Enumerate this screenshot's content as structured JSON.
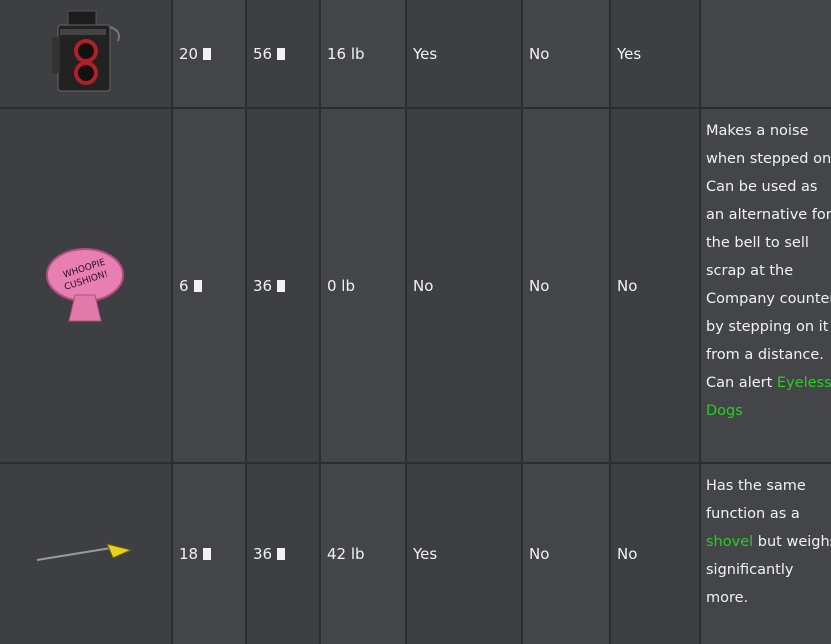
{
  "rows": [
    {
      "icon": "boombox-icon",
      "value_min": "20",
      "value_max": "56",
      "weight": "16 lb",
      "col5": "Yes",
      "col6": "No",
      "col7": "Yes",
      "description": []
    },
    {
      "icon": "whoopie-cushion-icon",
      "value_min": "6",
      "value_max": "36",
      "weight": "0 lb",
      "col5": "No",
      "col6": "No",
      "col7": "No",
      "description": [
        "Makes a noise when stepped on",
        "Can be used as an alternative for the bell to sell scrap at the Company counter by stepping on it from a distance.",
        "Can alert",
        "Eyeless Dogs"
      ],
      "description_link": "Eyeless Dogs"
    },
    {
      "icon": "yield-sign-icon",
      "value_min": "18",
      "value_max": "36",
      "weight": "42 lb",
      "col5": "Yes",
      "col6": "No",
      "col7": "No",
      "description": [
        "Has the same function as a",
        "shovel",
        "but weighs significantly more."
      ],
      "description_link": "shovel"
    }
  ],
  "currency_icon": "credit-icon",
  "link_color": "#27d01f"
}
